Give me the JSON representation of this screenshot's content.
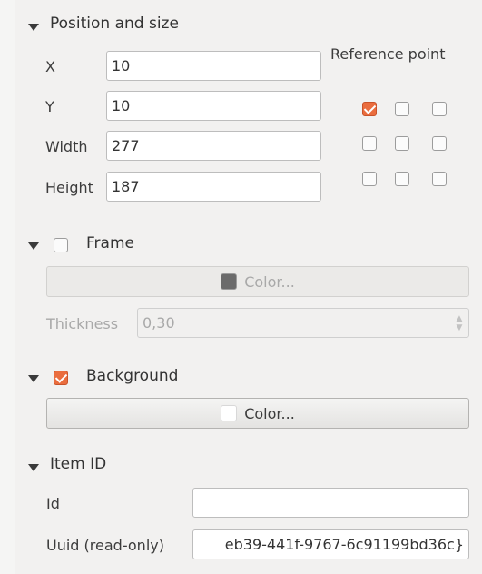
{
  "position_size": {
    "title": "Position and size",
    "x_label": "X",
    "x_value": "10",
    "y_label": "Y",
    "y_value": "10",
    "width_label": "Width",
    "width_value": "277",
    "height_label": "Height",
    "height_value": "187",
    "reference_point_label": "Reference point",
    "reference_point_checked": [
      true,
      false,
      false,
      false,
      false,
      false,
      false,
      false,
      false
    ]
  },
  "frame": {
    "title": "Frame",
    "checked": false,
    "color_label": "Color...",
    "color_swatch": "#6b6b6b",
    "thickness_label": "Thickness",
    "thickness_value": "0,30"
  },
  "background": {
    "title": "Background",
    "checked": true,
    "color_label": "Color...",
    "color_swatch": "#ffffff"
  },
  "item_id": {
    "title": "Item ID",
    "id_label": "Id",
    "id_value": "",
    "uuid_label": "Uuid (read-only)",
    "uuid_value": "eb39-441f-9767-6c91199bd36c}"
  },
  "colors": {
    "accent": "#ea6d3e",
    "panel_bg": "#f2f1f0"
  }
}
